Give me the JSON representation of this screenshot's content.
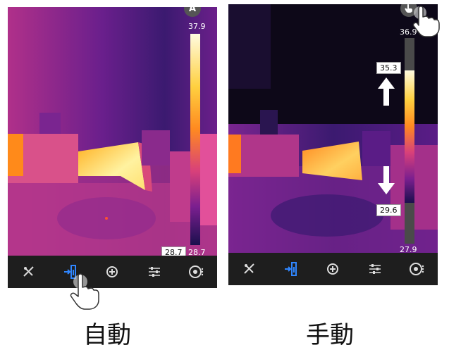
{
  "auto_screen": {
    "mode_badge": "A",
    "scale_max": "37.9",
    "scale_min_boxed": "28.7",
    "scale_min": "28.7"
  },
  "manual_screen": {
    "scale_max": "36.9",
    "upper_limit": "35.3",
    "lower_limit": "29.6",
    "scale_min": "27.9"
  },
  "toolbar_icons": [
    "measure-tools-icon",
    "palette-scale-icon",
    "spot-target-icon",
    "adjust-sliders-icon",
    "camera-switch-icon"
  ],
  "captions": {
    "auto": "自動",
    "manual": "手動"
  },
  "colors": {
    "accent_blue": "#2f86ff",
    "palette_hot": "#fff6c8",
    "palette_cold": "#1b0f4d"
  }
}
